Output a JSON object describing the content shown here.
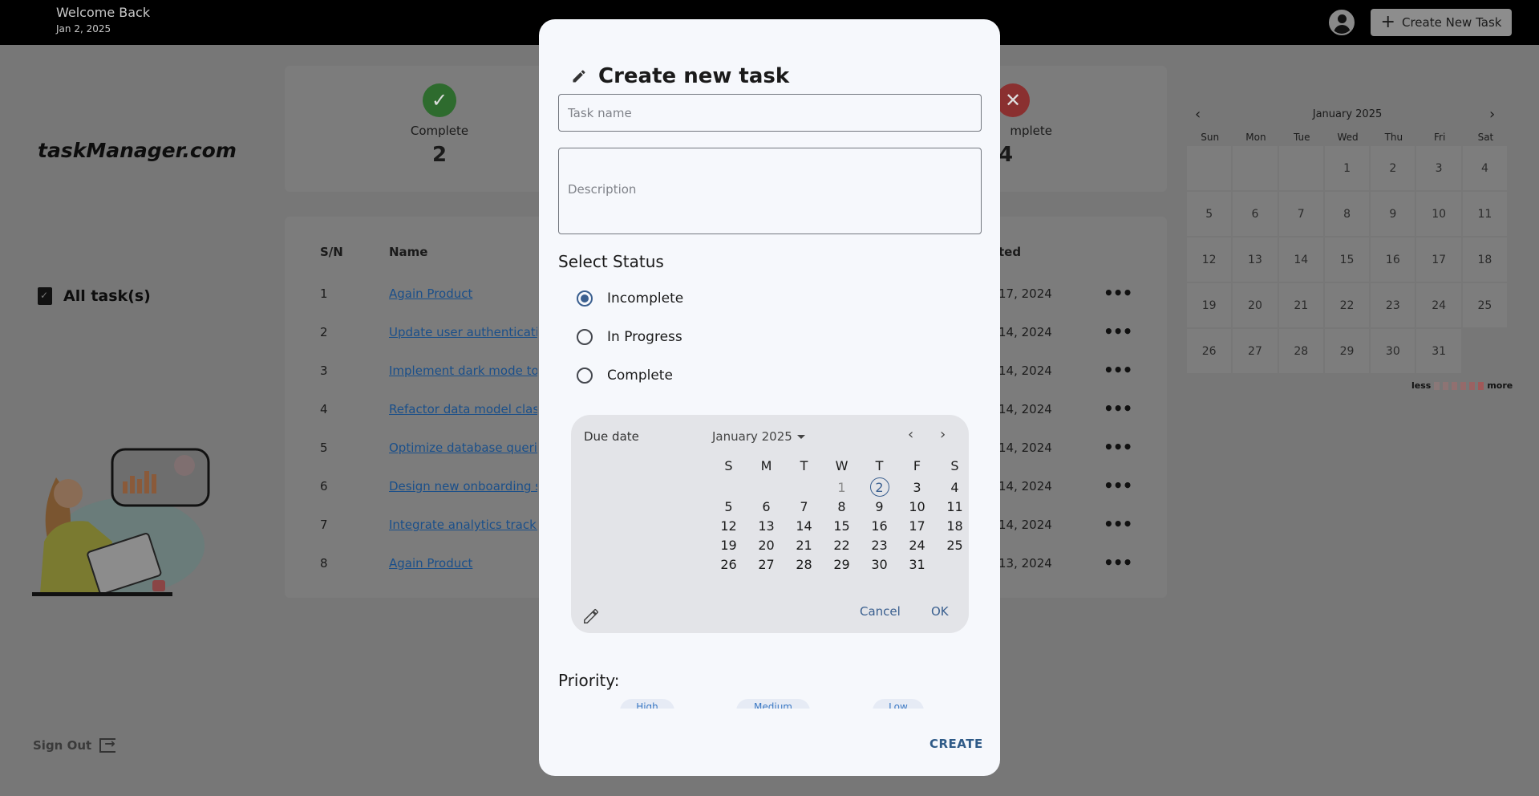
{
  "header": {
    "welcome": "Welcome Back",
    "date": "Jan 2, 2025",
    "create_label": "Create New Task"
  },
  "sidebar": {
    "brand": "taskManager.com",
    "nav_all": "All task(s)",
    "signout": "Sign Out"
  },
  "stats": {
    "complete_label": "Complete",
    "complete_value": "2",
    "incomplete_label": "mplete",
    "incomplete_value": "4"
  },
  "table": {
    "headers": {
      "sn": "S/N",
      "name": "Name",
      "date": "ted"
    },
    "rows": [
      {
        "sn": "1",
        "name": "Again Product",
        "date": "17, 2024"
      },
      {
        "sn": "2",
        "name": "Update user authenticati",
        "date": "14, 2024"
      },
      {
        "sn": "3",
        "name": "Implement dark mode tog",
        "date": "14, 2024"
      },
      {
        "sn": "4",
        "name": "Refactor data model class",
        "date": "14, 2024"
      },
      {
        "sn": "5",
        "name": "Optimize database querie",
        "date": "14, 2024"
      },
      {
        "sn": "6",
        "name": "Design new onboarding s",
        "date": "14, 2024"
      },
      {
        "sn": "7",
        "name": "Integrate analytics trackir",
        "date": "14, 2024"
      },
      {
        "sn": "8",
        "name": "Again Product",
        "date": "13, 2024"
      }
    ]
  },
  "calendar": {
    "title": "January 2025",
    "dow": [
      "Sun",
      "Mon",
      "Tue",
      "Wed",
      "Thu",
      "Fri",
      "Sat"
    ],
    "leading_blank": 3,
    "days": 31,
    "legend_less": "less",
    "legend_more": "more",
    "legend_colors": [
      "#8a7878",
      "#8d7474",
      "#917070",
      "#956a6a",
      "#9a6262",
      "#a05858"
    ]
  },
  "modal": {
    "title": "Create new task",
    "task_name_placeholder": "Task name",
    "description_placeholder": "Description",
    "status_title": "Select Status",
    "statuses": [
      "Incomplete",
      "In Progress",
      "Complete"
    ],
    "selected_status": "Incomplete",
    "picker": {
      "label": "Due date",
      "month": "January 2025",
      "dow": [
        "S",
        "M",
        "T",
        "W",
        "T",
        "F",
        "S"
      ],
      "leading_blank": 3,
      "days": 31,
      "today": 2,
      "cancel": "Cancel",
      "ok": "OK"
    },
    "priority_title": "Priority:",
    "priorities": [
      "High",
      "Medium",
      "Low"
    ],
    "create": "CREATE"
  },
  "colors": {
    "accent": "#3a5f8f",
    "complete_icon": "#2e6b2e",
    "incomplete_icon": "#8a3030"
  }
}
